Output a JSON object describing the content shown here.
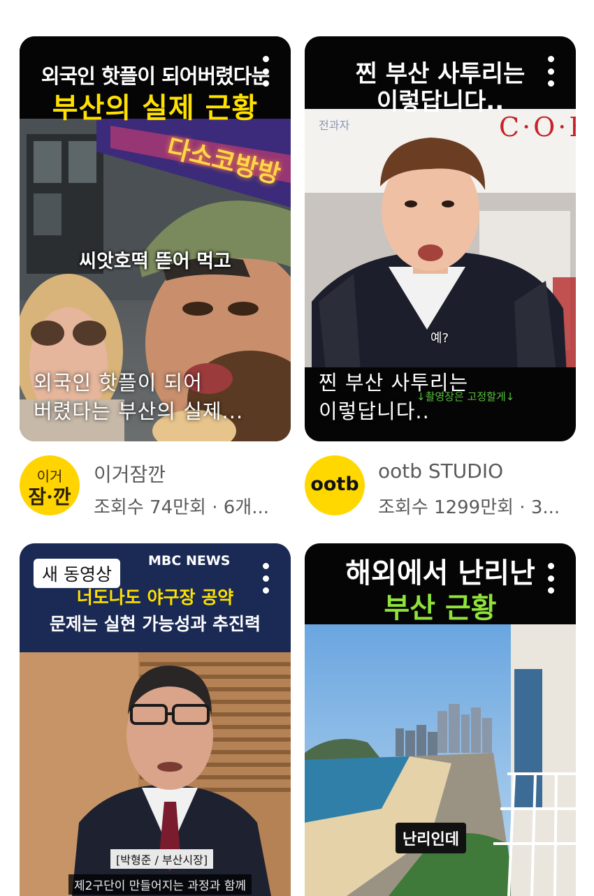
{
  "videos": [
    {
      "headline_line1": "외국인 핫플이 되어버렸다눈",
      "headline_line2": "부산의 실제 근황",
      "sign_text": "다소코방방",
      "subtitle": "씨앗호떡 뜯어 먹고",
      "title_line1": "외국인 핫플이 되어",
      "title_line2": "버렸다는 부산의 실제...",
      "channel": "이거잠깐",
      "avatar_text_top": "이거",
      "avatar_text_bottom": "잠·깐",
      "stats": "조회수 74만회 · 6개..."
    },
    {
      "headline_line1": "찐 부산 사투리는",
      "headline_line2": "이렇답니다..",
      "corner_mark": "전과자",
      "sign_text": "C·O·F",
      "small_sub": "예?",
      "overlay_green": "↓촬영장은 고정할게↓",
      "title_line1": "찐 부산 사투리는",
      "title_line2": "이렇답니다..",
      "channel": "ootb STUDIO",
      "avatar_text": "ootb",
      "stats": "조회수 1299만회 · 3..."
    },
    {
      "badge": "새 동영상",
      "news_logo": "MBC NEWS",
      "headline_line1": "너도나도 야구장 공약",
      "headline_line2": "문제는 실현 가능성과 추진력",
      "name_tag": "[박형준 / 부산시장]",
      "bottom_sub": "제2구단이 만들어지는 과정과 함께"
    },
    {
      "headline_line1": "해외에서 난리난",
      "headline_line2": "부산 근황",
      "subtitle": "난리인데"
    }
  ],
  "colors": {
    "yellow": "#ffe100",
    "green": "#8fe33a",
    "ootb_yellow": "#ffd800",
    "meta_text": "#5a5a5a"
  }
}
